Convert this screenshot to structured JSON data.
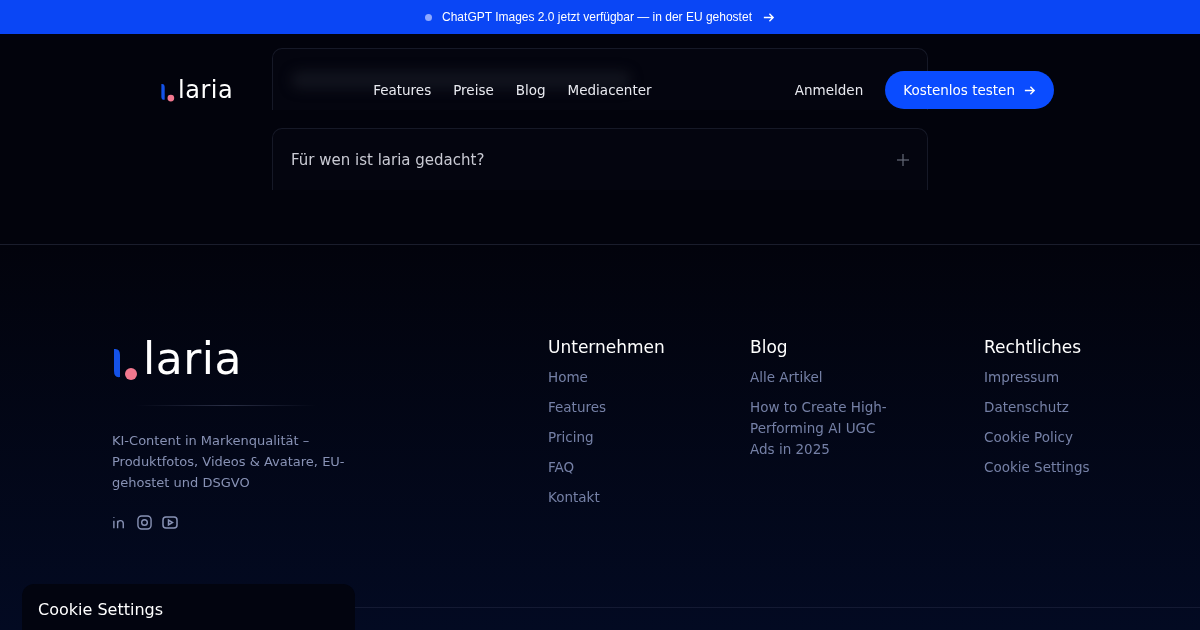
{
  "banner": {
    "text": "ChatGPT Images 2.0 jetzt verfügbar — in der EU gehostet"
  },
  "nav": {
    "logo": "laria",
    "links": [
      "Features",
      "Preise",
      "Blog",
      "Mediacenter"
    ],
    "login": "Anmelden",
    "cta": "Kostenlos testen"
  },
  "faq": [
    {
      "question": "Für wen ist laria gedacht?",
      "expanded": false
    }
  ],
  "footer": {
    "logo": "laria",
    "tagline": "KI-Content in Markenqualität – Produktfotos, Videos & Avatare, EU-gehostet und DSGVO",
    "columns": [
      {
        "title": "Unternehmen",
        "links": [
          "Home",
          "Features",
          "Pricing",
          "FAQ",
          "Kontakt"
        ]
      },
      {
        "title": "Blog",
        "links": [
          "Alle Artikel",
          "How to Create High-Performing AI UGC Ads in 2025"
        ]
      },
      {
        "title": "Rechtliches",
        "links": [
          "Impressum",
          "Datenschutz",
          "Cookie Policy",
          "Cookie Settings"
        ]
      }
    ]
  },
  "cookie_panel": {
    "title": "Cookie Settings"
  }
}
